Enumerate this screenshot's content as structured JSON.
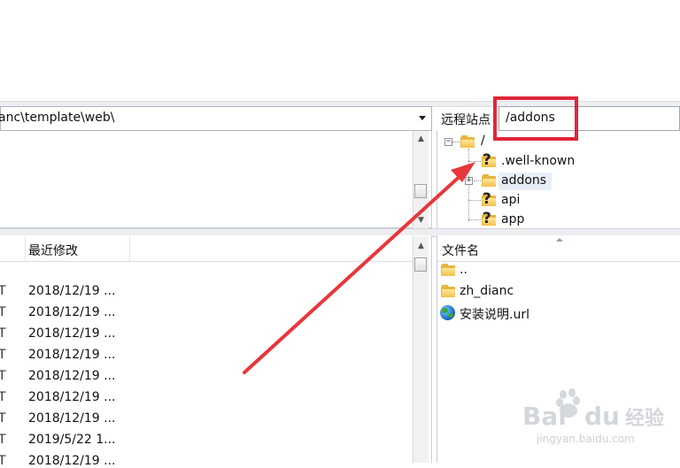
{
  "local": {
    "path": "anc\\template\\web\\",
    "list_header": {
      "modified_label": "最近修改"
    },
    "rows": [
      {
        "type_trunc": "T",
        "modified": "2018/12/19 ..."
      },
      {
        "type_trunc": "T",
        "modified": "2018/12/19 ..."
      },
      {
        "type_trunc": "T",
        "modified": "2018/12/19 ..."
      },
      {
        "type_trunc": "T",
        "modified": "2018/12/19 ..."
      },
      {
        "type_trunc": "T",
        "modified": "2018/12/19 ..."
      },
      {
        "type_trunc": "T",
        "modified": "2018/12/19 ..."
      },
      {
        "type_trunc": "T",
        "modified": "2018/12/19 ..."
      },
      {
        "type_trunc": "T",
        "modified": "2019/5/22 1..."
      },
      {
        "type_trunc": "T",
        "modified": "2018/12/19 ..."
      }
    ]
  },
  "remote": {
    "label": "远程站点",
    "path": "/addons",
    "tree": {
      "root": "/",
      "children": [
        {
          "name": ".well-known",
          "icon": "unknown-folder-icon"
        },
        {
          "name": "addons",
          "icon": "folder-icon"
        },
        {
          "name": "api",
          "icon": "unknown-folder-icon"
        },
        {
          "name": "app",
          "icon": "unknown-folder-icon"
        }
      ]
    },
    "list_header": {
      "name_label": "文件名"
    },
    "files": [
      {
        "name": "..",
        "icon": "folder-icon"
      },
      {
        "name": "zh_dianc",
        "icon": "folder-icon"
      },
      {
        "name": "安装说明.url",
        "icon": "globe-icon"
      }
    ]
  },
  "annotation": {
    "highlight_color": "#e0263a"
  },
  "watermark": {
    "logo": "Bai du 经验",
    "url": "jingyan.baidu.com"
  }
}
